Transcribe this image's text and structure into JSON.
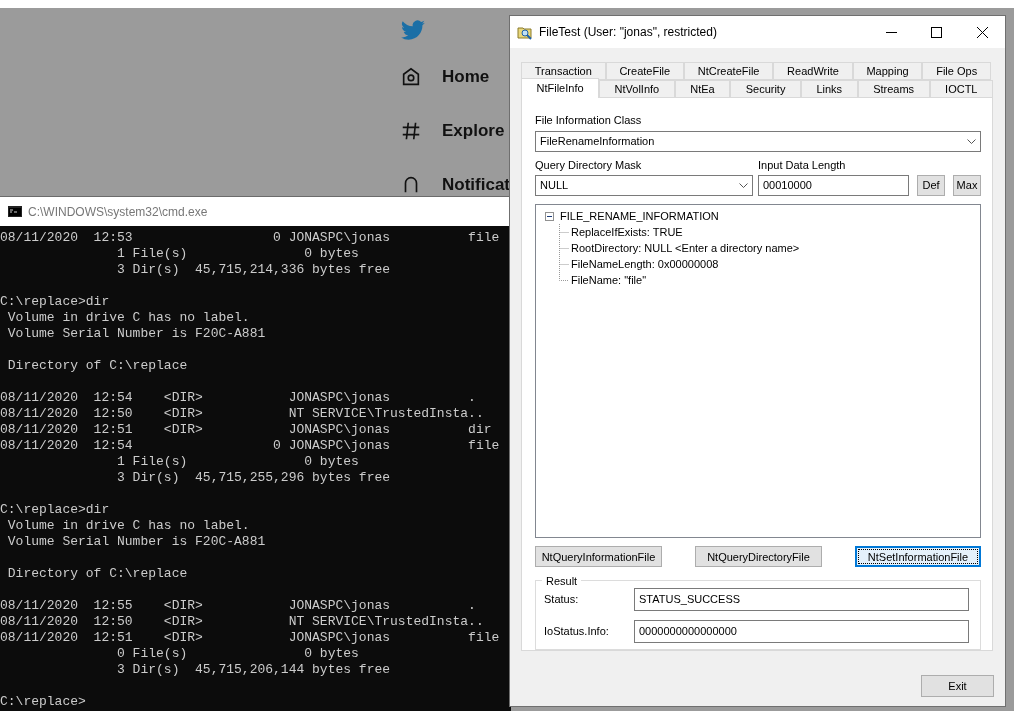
{
  "background_page": {
    "nav_items": [
      {
        "label": "Home",
        "kind": "home"
      },
      {
        "label": "Explore",
        "kind": "explore"
      },
      {
        "label": "Notificat",
        "kind": "notifications"
      }
    ]
  },
  "console_window": {
    "title": "C:\\WINDOWS\\system32\\cmd.exe",
    "blocks": [
      [
        "08/11/2020  12:53                  0 JONASPC\\jonas          file",
        "               1 File(s)               0 bytes",
        "               3 Dir(s)  45,715,214,336 bytes free"
      ],
      [
        "C:\\replace>dir",
        " Volume in drive C has no label.",
        " Volume Serial Number is F20C-A881"
      ],
      [
        " Directory of C:\\replace"
      ],
      [
        "08/11/2020  12:54    <DIR>           JONASPC\\jonas          .",
        "08/11/2020  12:50    <DIR>           NT SERVICE\\TrustedInsta..",
        "08/11/2020  12:51    <DIR>           JONASPC\\jonas          dir",
        "08/11/2020  12:54                  0 JONASPC\\jonas          file",
        "               1 File(s)               0 bytes",
        "               3 Dir(s)  45,715,255,296 bytes free"
      ],
      [
        "C:\\replace>dir",
        " Volume in drive C has no label.",
        " Volume Serial Number is F20C-A881"
      ],
      [
        " Directory of C:\\replace"
      ],
      [
        "08/11/2020  12:55    <DIR>           JONASPC\\jonas          .",
        "08/11/2020  12:50    <DIR>           NT SERVICE\\TrustedInsta..",
        "08/11/2020  12:51    <DIR>           JONASPC\\jonas          file",
        "               0 File(s)               0 bytes",
        "               3 Dir(s)  45,715,206,144 bytes free"
      ],
      [
        "C:\\replace>"
      ]
    ]
  },
  "filetest_window": {
    "title": "FileTest (User: \"jonas\", restricted)",
    "tab_rows": [
      [
        {
          "label": "Transaction",
          "selected": false
        },
        {
          "label": "CreateFile",
          "selected": false
        },
        {
          "label": "NtCreateFile",
          "selected": false
        },
        {
          "label": "ReadWrite",
          "selected": false
        },
        {
          "label": "Mapping",
          "selected": false
        },
        {
          "label": "File Ops",
          "selected": false
        }
      ],
      [
        {
          "label": "NtFileInfo",
          "selected": true
        },
        {
          "label": "NtVolInfo",
          "selected": false
        },
        {
          "label": "NtEa",
          "selected": false
        },
        {
          "label": "Security",
          "selected": false
        },
        {
          "label": "Links",
          "selected": false
        },
        {
          "label": "Streams",
          "selected": false
        },
        {
          "label": "IOCTL",
          "selected": false
        }
      ]
    ],
    "file_information_class": {
      "label": "File Information Class",
      "value": "FileRenameInformation"
    },
    "query_directory_mask": {
      "label": "Query Directory Mask",
      "value": "NULL"
    },
    "input_data_length": {
      "label": "Input Data Length",
      "value": "00010000"
    },
    "length_buttons": [
      "Def",
      "Max"
    ],
    "tree": {
      "label": "FILE_RENAME_INFORMATION",
      "expanded": true,
      "children": [
        {
          "label": "ReplaceIfExists: TRUE"
        },
        {
          "label": "RootDirectory: NULL <Enter a directory name>"
        },
        {
          "label": "FileNameLength: 0x00000008"
        },
        {
          "label": "FileName: \"file\""
        }
      ]
    },
    "actions": [
      {
        "label": "NtQueryInformationFile",
        "focused": false
      },
      {
        "label": "NtQueryDirectoryFile",
        "focused": false
      },
      {
        "label": "NtSetInformationFile",
        "focused": true
      }
    ],
    "result": {
      "title": "Result",
      "fields": [
        {
          "label": "Status:",
          "value": "STATUS_SUCCESS"
        },
        {
          "label": "IoStatus.Info:",
          "value": "0000000000000000"
        }
      ]
    },
    "exit_button": "Exit"
  }
}
